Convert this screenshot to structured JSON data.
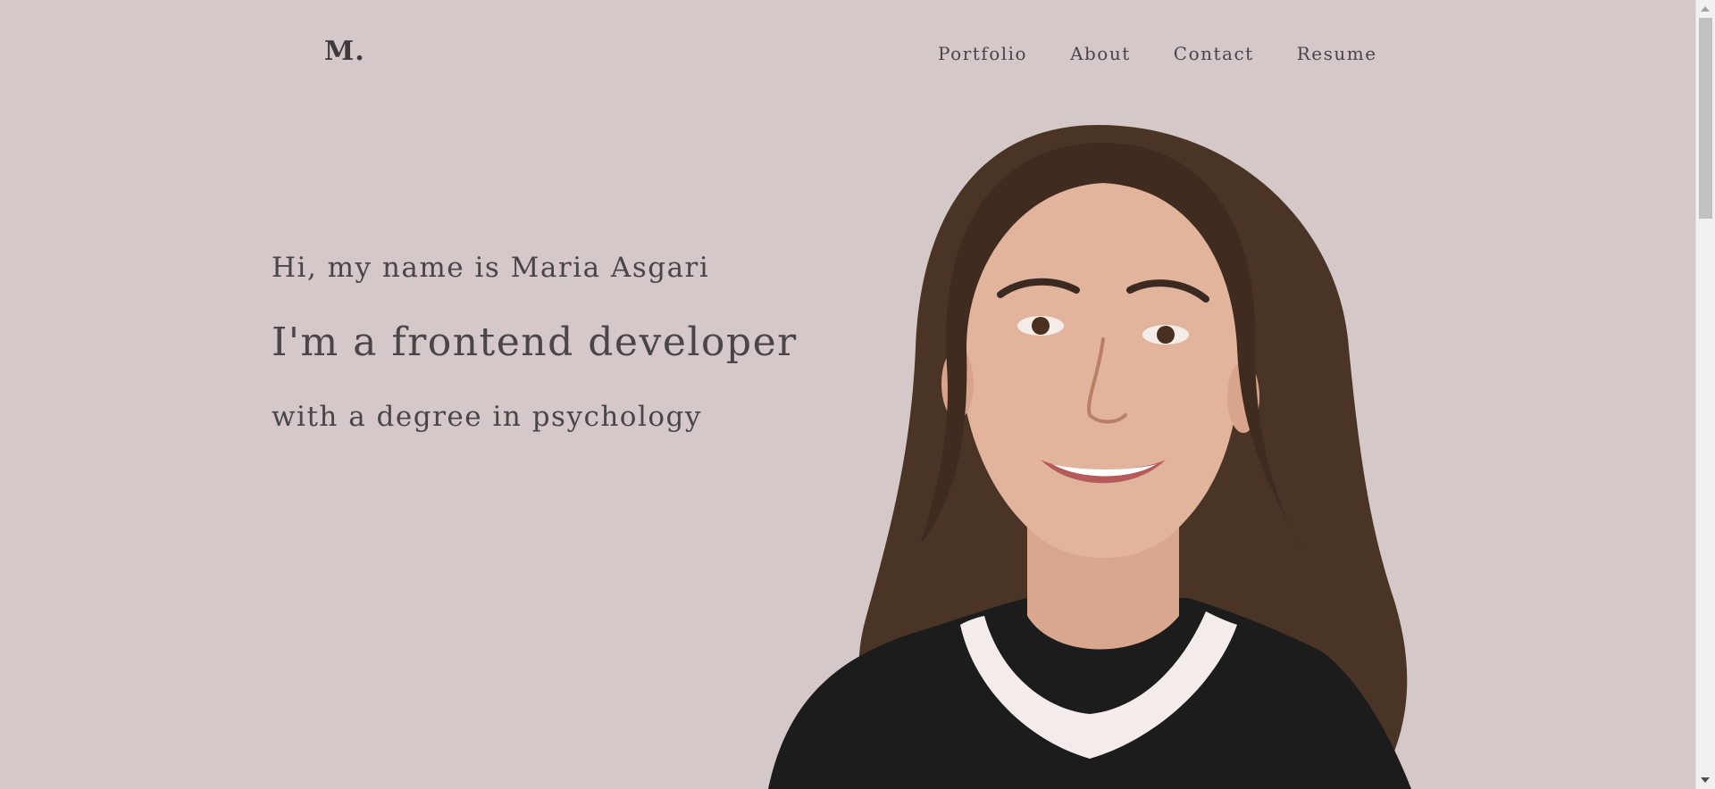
{
  "header": {
    "logo": "M.",
    "nav": [
      "Portfolio",
      "About",
      "Contact",
      "Resume"
    ]
  },
  "hero": {
    "greeting": "Hi, my name is Maria Asgari",
    "role": "I'm a frontend developer",
    "degree": "with a degree in psychology"
  },
  "colors": {
    "background": "#d4c8c8",
    "text": "#4a4646",
    "hair": "#4a3426",
    "skin": "#e2b49c",
    "shirt": "#1c1c1c"
  },
  "portrait": {
    "icon": "portrait-photo-icon"
  }
}
